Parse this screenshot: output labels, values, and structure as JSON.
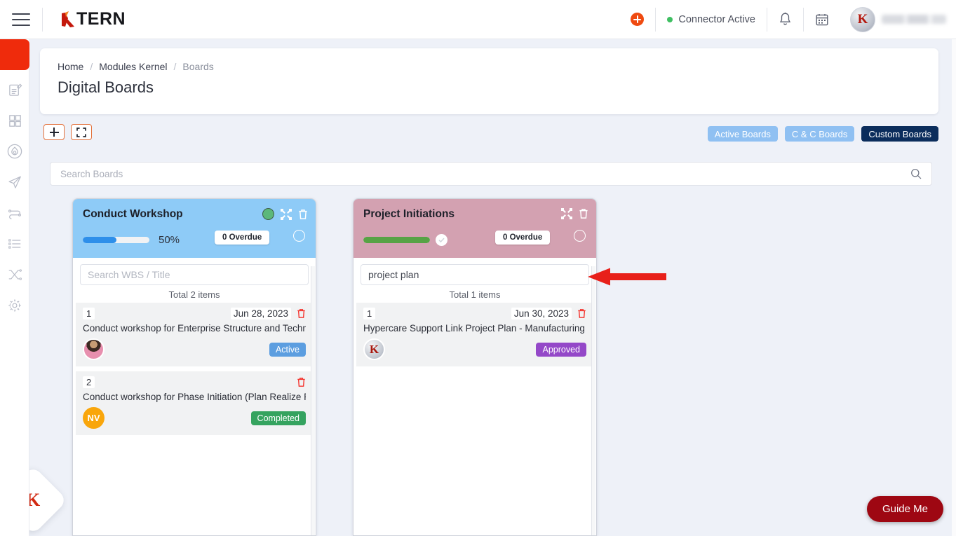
{
  "topbar": {
    "menu_icon": "hamburger-icon",
    "brand": "TERN",
    "brand_mark": "K",
    "add_icon": "plus-circle-icon",
    "connector_status": "Connector Active",
    "notifications_icon": "bell-icon",
    "calendar_icon": "calendar-icon",
    "avatar_letter": "K",
    "user_name": ""
  },
  "sidebar": {
    "items": [
      {
        "name": "sidebar-item-active",
        "icon": "active-block"
      },
      {
        "name": "sidebar-item-notes",
        "icon": "note-edit-icon"
      },
      {
        "name": "sidebar-item-modules",
        "icon": "grid-icon"
      },
      {
        "name": "sidebar-item-ignite",
        "icon": "flame-circle-icon"
      },
      {
        "name": "sidebar-item-deploy",
        "icon": "paper-plane-icon"
      },
      {
        "name": "sidebar-item-process",
        "icon": "flow-icon"
      },
      {
        "name": "sidebar-item-lists",
        "icon": "list-icon"
      },
      {
        "name": "sidebar-item-shuffle",
        "icon": "shuffle-icon"
      },
      {
        "name": "sidebar-item-settings",
        "icon": "gear-icon"
      }
    ]
  },
  "breadcrumb": {
    "home": "Home",
    "section": "Modules Kernel",
    "current": "Boards",
    "separator": "/"
  },
  "page": {
    "title": "Digital Boards"
  },
  "toolbar": {
    "add_icon": "plus-icon",
    "fullscreen_icon": "expand-icon",
    "filters": [
      {
        "label": "Active Boards",
        "active": false
      },
      {
        "label": "C & C Boards",
        "active": false
      },
      {
        "label": "Custom Boards",
        "active": true
      }
    ]
  },
  "search": {
    "placeholder": "Search Boards",
    "value": "",
    "icon": "search-icon"
  },
  "boards": [
    {
      "title": "Conduct Workshop",
      "header_color": "#8ecbf7",
      "status_dot": "#5cb87a",
      "expand_icon": "expand-icon",
      "delete_icon": "trash-icon",
      "progress_percent": 50,
      "progress_label": "50%",
      "progress_color": "#2e8fea",
      "overdue_label": "0 Overdue",
      "search_placeholder": "Search WBS / Title",
      "search_value": "",
      "total_label": "Total 2 items",
      "items": [
        {
          "number": "1",
          "date": "Jun 28, 2023",
          "title": "Conduct workshop for Enterprise Structure and Techni...",
          "avatar_type": "photo",
          "avatar_text": "",
          "status": "Active",
          "status_color": "#5c9ee0",
          "delete_icon": "trash-icon"
        },
        {
          "number": "2",
          "date": "",
          "title": "Conduct workshop for Phase Initiation (Plan Realize Ph...",
          "avatar_type": "initials",
          "avatar_text": "NV",
          "status": "Completed",
          "status_color": "#35a35f",
          "delete_icon": "trash-icon"
        }
      ]
    },
    {
      "title": "Project Initiations",
      "header_color": "#d3a1b1",
      "status_dot": "",
      "expand_icon": "expand-icon",
      "delete_icon": "trash-icon",
      "progress_percent": 100,
      "progress_label": "",
      "progress_color": "#57a345",
      "overdue_label": "0 Overdue",
      "search_placeholder": "",
      "search_value": "project plan",
      "total_label": "Total 1 items",
      "items": [
        {
          "number": "1",
          "date": "Jun 30, 2023",
          "title": "Hypercare Support Link Project Plan - Manufacturing",
          "avatar_type": "ktern",
          "avatar_text": "K",
          "status": "Approved",
          "status_color": "#9448c8",
          "delete_icon": "trash-icon"
        }
      ]
    }
  ],
  "annotation": {
    "arrow": "red-left-arrow",
    "color": "#e8201a"
  },
  "widgets": {
    "assistant_label": "K",
    "guide_label": "Guide Me",
    "guide_color": "#9e0712"
  }
}
